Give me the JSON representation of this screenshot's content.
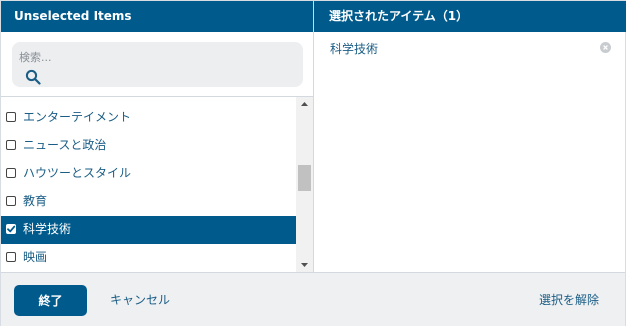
{
  "left_panel": {
    "title": "Unselected Items",
    "search_placeholder": "検索...",
    "items": [
      {
        "label": "エンターテイメント",
        "checked": false
      },
      {
        "label": "ニュースと政治",
        "checked": false
      },
      {
        "label": "ハウツーとスタイル",
        "checked": false
      },
      {
        "label": "教育",
        "checked": false
      },
      {
        "label": "科学技術",
        "checked": true
      },
      {
        "label": "映画",
        "checked": false
      }
    ]
  },
  "right_panel": {
    "title": "選択されたアイテム（1）",
    "items": [
      {
        "label": "科学技術"
      }
    ]
  },
  "footer": {
    "done_label": "終了",
    "cancel_label": "キャンセル",
    "clear_label": "選択を解除"
  },
  "colors": {
    "header_bg": "#005a8c",
    "link": "#1a5d85",
    "footer_bg": "#eef0f2"
  }
}
